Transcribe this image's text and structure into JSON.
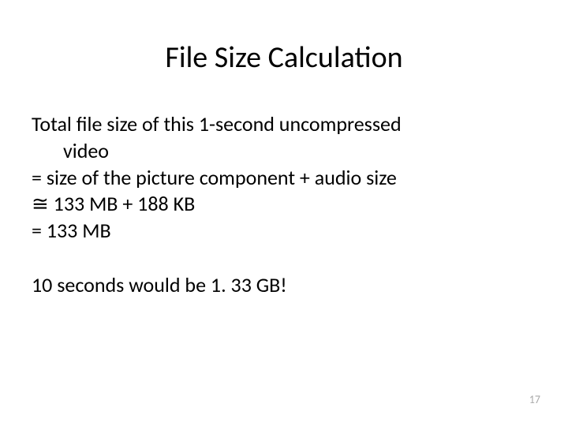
{
  "title": "File Size Calculation",
  "line1": "Total file size of this 1-second uncompressed",
  "line1b": "video",
  "line2": "= size of the picture component + audio size",
  "line3": "≅ 133 MB + 188 KB",
  "line4": "= 133 MB",
  "line5": "10 seconds would be 1. 33 GB!",
  "pageNumber": "17"
}
